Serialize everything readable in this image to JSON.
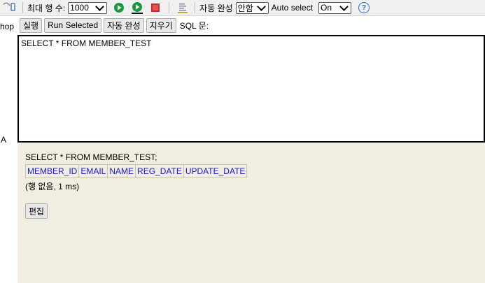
{
  "toolbar": {
    "max_rows_label": "최대 행 수:",
    "max_rows_value": "1000",
    "autocomplete_label": "자동 완성",
    "autocomplete_value": "안함",
    "auto_select_label": "Auto select",
    "auto_select_value": "On",
    "colors": {
      "run_green": "#1a9a3a",
      "stop_red": "#d22a2a",
      "help_blue": "#2a6fcf"
    }
  },
  "left": {
    "hop": "hop",
    "a_label": "A"
  },
  "actions": {
    "run": "실행",
    "run_selected": "Run Selected",
    "autocomplete": "자동 완성",
    "clear": "지우기",
    "sql_label": "SQL 문:"
  },
  "editor": {
    "text": "SELECT * FROM MEMBER_TEST"
  },
  "results": {
    "query": "SELECT * FROM MEMBER_TEST;",
    "columns": [
      "MEMBER_ID",
      "EMAIL",
      "NAME",
      "REG_DATE",
      "UPDATE_DATE"
    ],
    "meta": "(행 없음, 1 ms)",
    "edit_button": "편집"
  }
}
